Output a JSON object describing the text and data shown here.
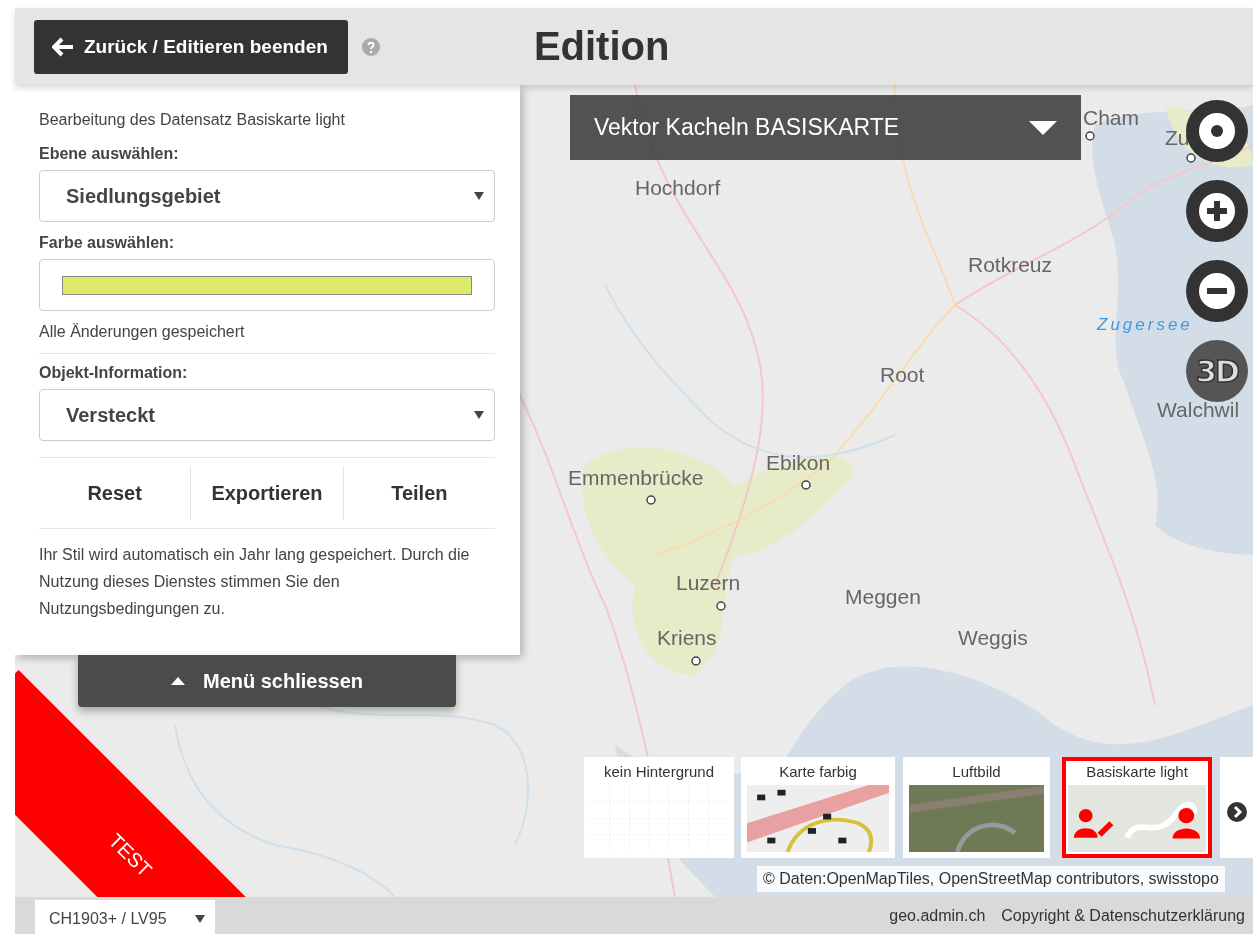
{
  "header": {
    "back_button": "Zurück / Editieren beenden",
    "title": "Edition"
  },
  "panel": {
    "caption": "Bearbeitung des Datensatz Basiskarte light",
    "layer_label": "Ebene auswählen:",
    "layer_select": "Siedlungsgebiet",
    "color_label": "Farbe auswählen:",
    "color": "#dce96b",
    "save_status": "Alle Änderungen gespeichert",
    "info_label": "Objekt-Information:",
    "info_select": "Versteckt",
    "actions": [
      "Reset",
      "Exportieren",
      "Teilen"
    ],
    "notice": "Ihr Stil wird automatisch ein Jahr lang gespeichert. Durch die Nutzung dieses Dienstes stimmen Sie den Nutzungsbedingungen zu.",
    "close_button": "Menü schliessen"
  },
  "map": {
    "layer_dropdown": "Vektor Kacheln BASISKARTE",
    "place_labels": [
      {
        "kind": "town",
        "text": "Cham"
      },
      {
        "kind": "town",
        "text": "Zu"
      },
      {
        "kind": "town",
        "text": "Hochdorf"
      },
      {
        "kind": "town",
        "text": "Rotkreuz"
      },
      {
        "kind": "lake",
        "text": "Zugersee"
      },
      {
        "kind": "town",
        "text": "Root"
      },
      {
        "kind": "town",
        "text": "Walchwil"
      },
      {
        "kind": "town",
        "text": "Ebikon"
      },
      {
        "kind": "town",
        "text": "Emmenbrücke"
      },
      {
        "kind": "town",
        "text": "Luzern"
      },
      {
        "kind": "town",
        "text": "Meggen"
      },
      {
        "kind": "town",
        "text": "Kriens"
      },
      {
        "kind": "town",
        "text": "Weggis"
      }
    ],
    "three_d_button": "3D",
    "background_tiles": [
      {
        "kind": "empty",
        "label": "kein Hintergrund",
        "selected": false
      },
      {
        "kind": "color",
        "label": "Karte farbig",
        "selected": false
      },
      {
        "kind": "aerial",
        "label": "Luftbild",
        "selected": false
      },
      {
        "kind": "light",
        "label": "Basiskarte light",
        "selected": true
      }
    ],
    "attribution": "© Daten:OpenMapTiles, OpenStreetMap contributors, swisstopo",
    "ribbon": "TEST"
  },
  "footer": {
    "projection": "CH1903+ / LV95",
    "links": [
      "geo.admin.ch",
      "Copyright & Datenschutzerklärung"
    ]
  }
}
